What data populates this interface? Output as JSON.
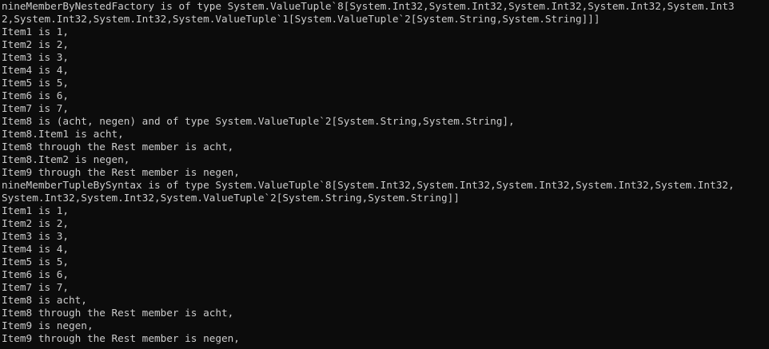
{
  "console": {
    "text_color": "#cccccc",
    "background_color": "#0c0c0c",
    "lines": [
      "nineMemberByNestedFactory is of type System.ValueTuple`8[System.Int32,System.Int32,System.Int32,System.Int32,System.Int3",
      "2,System.Int32,System.Int32,System.ValueTuple`1[System.ValueTuple`2[System.String,System.String]]]",
      "Item1 is 1,",
      "Item2 is 2,",
      "Item3 is 3,",
      "Item4 is 4,",
      "Item5 is 5,",
      "Item6 is 6,",
      "Item7 is 7,",
      "Item8 is (acht, negen) and of type System.ValueTuple`2[System.String,System.String],",
      "Item8.Item1 is acht,",
      "Item8 through the Rest member is acht,",
      "Item8.Item2 is negen,",
      "Item9 through the Rest member is negen,",
      "nineMemberTupleBySyntax is of type System.ValueTuple`8[System.Int32,System.Int32,System.Int32,System.Int32,System.Int32,",
      "System.Int32,System.Int32,System.ValueTuple`2[System.String,System.String]]",
      "Item1 is 1,",
      "Item2 is 2,",
      "Item3 is 3,",
      "Item4 is 4,",
      "Item5 is 5,",
      "Item6 is 6,",
      "Item7 is 7,",
      "Item8 is acht,",
      "Item8 through the Rest member is acht,",
      "Item9 is negen,",
      "Item9 through the Rest member is negen,"
    ]
  }
}
